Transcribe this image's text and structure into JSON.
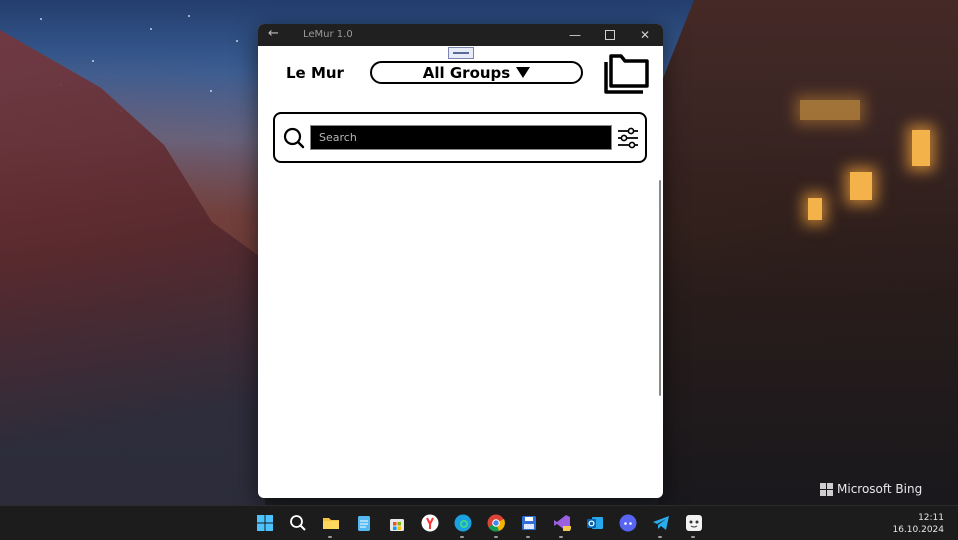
{
  "window": {
    "title": "LeMur 1.0"
  },
  "header": {
    "app_title": "Le Mur",
    "group_selector_label": "All Groups"
  },
  "search": {
    "placeholder": "Search",
    "value": ""
  },
  "desktop": {
    "watermark": "Microsoft Bing"
  },
  "taskbar": {
    "time": "12:11",
    "date": "16.10.2024",
    "icons": [
      "windows-start-icon",
      "search-icon",
      "file-explorer-icon",
      "notepad-icon",
      "microsoft-store-icon",
      "yandex-browser-icon",
      "edge-icon",
      "chrome-icon",
      "save-app-icon",
      "visual-studio-preview-icon",
      "outlook-icon",
      "discord-icon",
      "telegram-icon",
      "pet-app-icon"
    ]
  }
}
